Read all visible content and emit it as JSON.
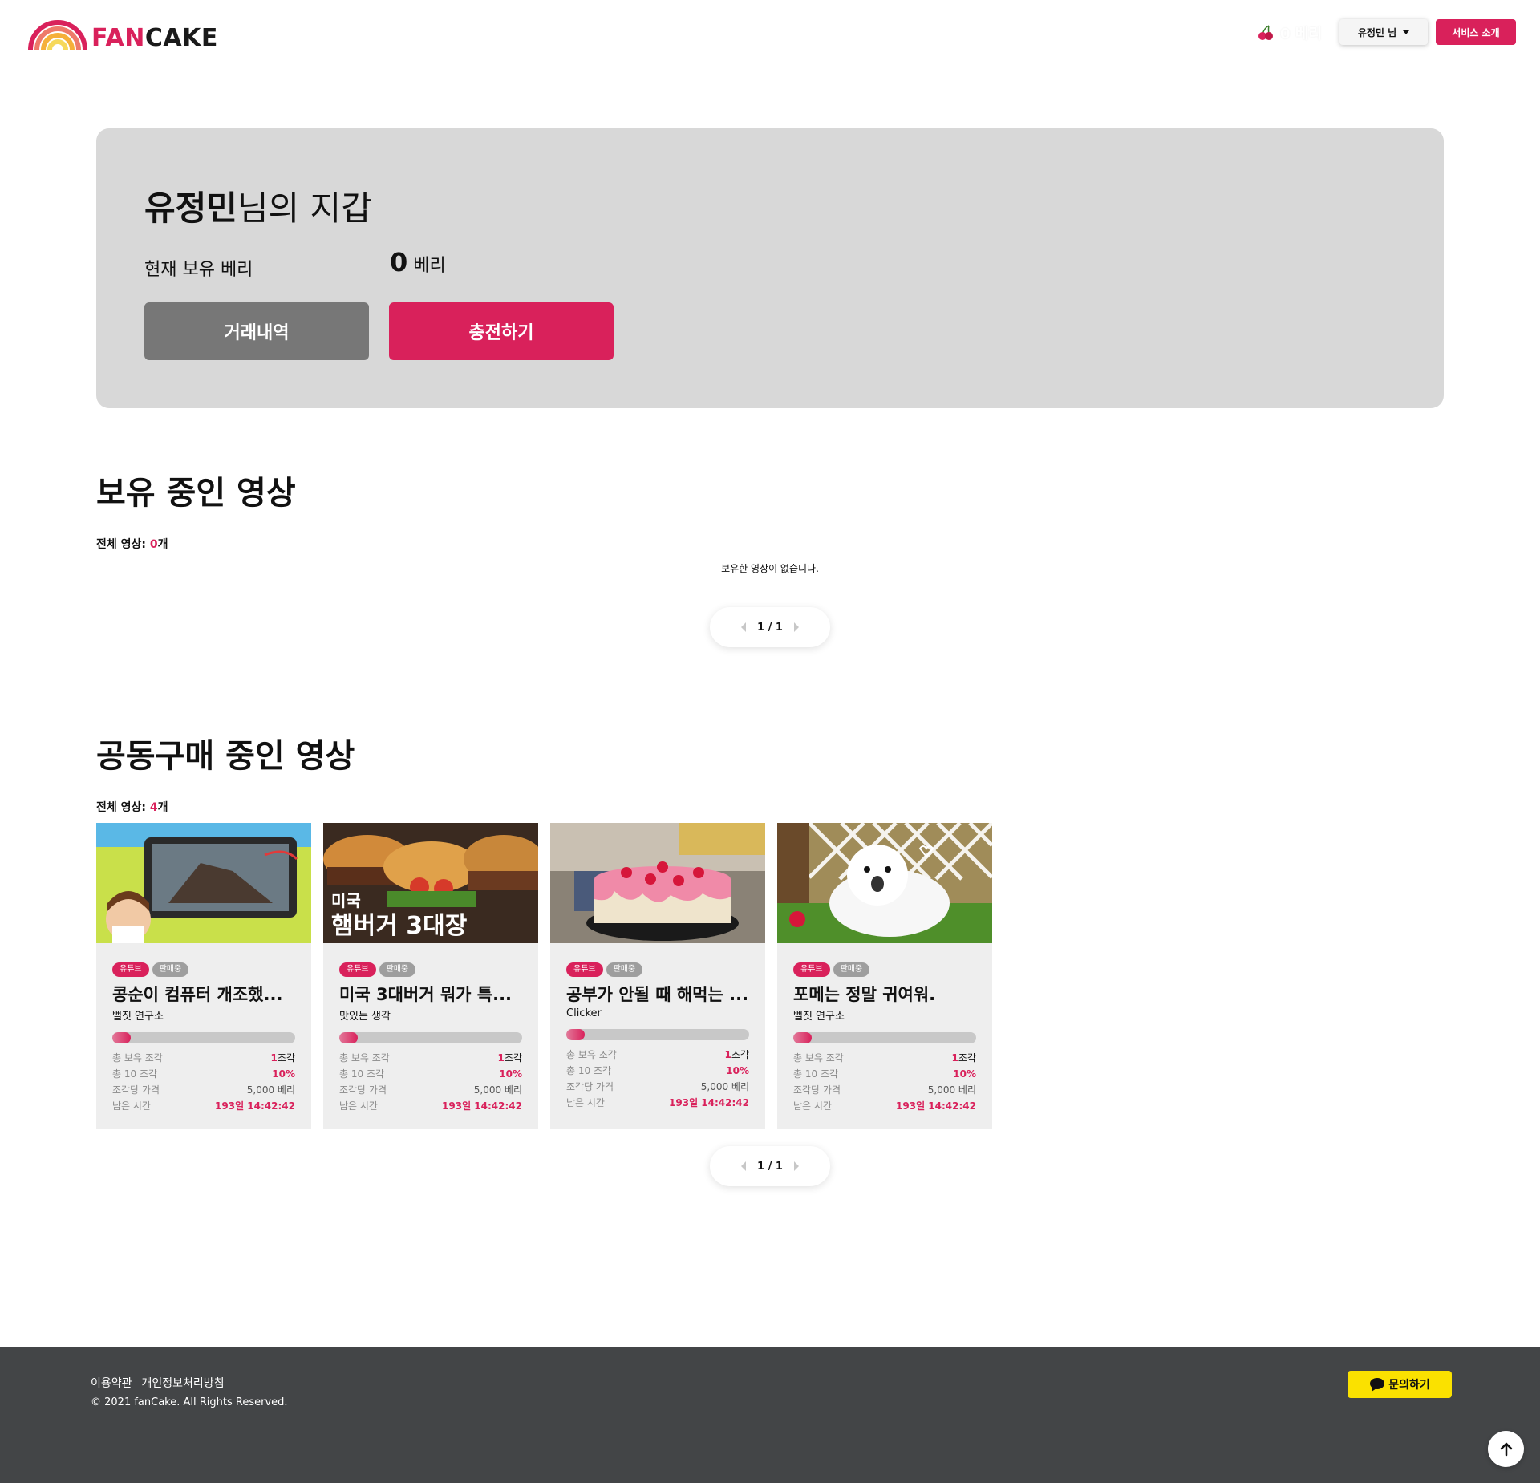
{
  "header": {
    "logo": {
      "part1": "FAN",
      "part2": "CAKE"
    },
    "berry_balance": "0 베리",
    "user_menu": "유정민 님",
    "service_intro": "서비스 소개"
  },
  "wallet": {
    "user_name": "유정민",
    "title_suffix": "님의 지갑",
    "balance_label": "현재 보유 베리",
    "balance_value": "0",
    "balance_unit": "베리",
    "history_button": "거래내역",
    "charge_button": "충전하기"
  },
  "owned": {
    "title": "보유 중인 영상",
    "count_label": "전체 영상: ",
    "count_value": "0",
    "count_unit": "개",
    "empty_message": "보유한 영상이 없습니다.",
    "pager": "1 / 1"
  },
  "group_buy": {
    "title": "공동구매 중인 영상",
    "count_label": "전체 영상: ",
    "count_value": "4",
    "count_unit": "개",
    "pager": "1 / 1",
    "stat_labels": {
      "owned": "총 보유 조각",
      "total": "총 10 조각",
      "price": "조각당 가격",
      "remaining": "남은 시간"
    },
    "cards": [
      {
        "tag1": "유튜브",
        "tag2": "판매중",
        "title": "콩순이 컴퓨터 개조했...",
        "channel": "뻘짓 연구소",
        "progress": 0.1,
        "owned_num": "1",
        "owned_unit": "조각",
        "percent": "10%",
        "price": "5,000 베리",
        "remaining": "193일 14:42:42"
      },
      {
        "tag1": "유튜브",
        "tag2": "판매중",
        "title": "미국 3대버거 뭐가 특...",
        "channel": "맛있는 생각",
        "progress": 0.1,
        "owned_num": "1",
        "owned_unit": "조각",
        "percent": "10%",
        "price": "5,000 베리",
        "remaining": "193일 14:42:42",
        "thumb_text1": "미국",
        "thumb_text2": "햄버거 3대장"
      },
      {
        "tag1": "유튜브",
        "tag2": "판매중",
        "title": "공부가 안될 때 해먹는 ...",
        "channel": "Clicker",
        "progress": 0.1,
        "owned_num": "1",
        "owned_unit": "조각",
        "percent": "10%",
        "price": "5,000 베리",
        "remaining": "193일 14:42:42"
      },
      {
        "tag1": "유튜브",
        "tag2": "판매중",
        "title": "포메는 정말 귀여워.",
        "channel": "뻘짓 연구소",
        "progress": 0.1,
        "owned_num": "1",
        "owned_unit": "조각",
        "percent": "10%",
        "price": "5,000 베리",
        "remaining": "193일 14:42:42"
      }
    ]
  },
  "footer": {
    "terms": "이용약관",
    "privacy": "개인정보처리방침",
    "copyright": "© 2021 fanCake. All Rights Reserved.",
    "inquiry": "문의하기"
  },
  "colors": {
    "accent": "#d9215b",
    "wallet_bg": "#d8d8d8",
    "footer_bg": "#434547",
    "kakao": "#fae100"
  }
}
